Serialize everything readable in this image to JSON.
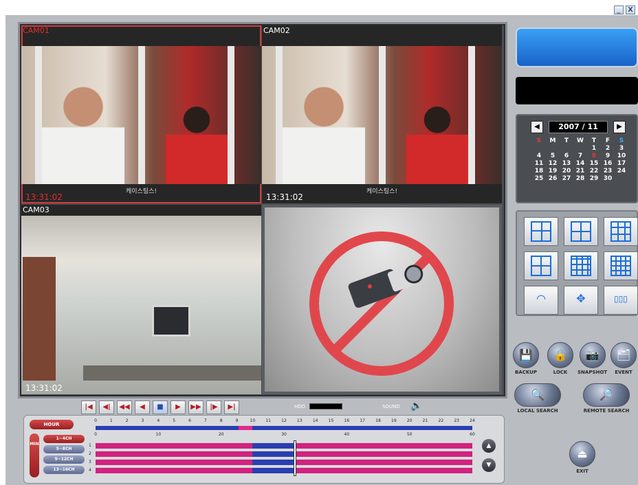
{
  "window": {
    "minimize_glyph": "_",
    "close_glyph": "X"
  },
  "cameras": [
    {
      "label": "CAM01",
      "time": "13:31:02",
      "caption": "케이스팅스!",
      "active": true
    },
    {
      "label": "CAM02",
      "time": "13:31:02",
      "caption": "케이스팅스!",
      "active": false
    },
    {
      "label": "CAM03",
      "time": "13:31:02",
      "active": false
    },
    {
      "label": "",
      "time": "",
      "no_signal": true
    }
  ],
  "playback": {
    "buttons": [
      {
        "name": "first-frame-button",
        "glyph": "|◀"
      },
      {
        "name": "prev-frame-button",
        "glyph": "◀|"
      },
      {
        "name": "fast-rewind-button",
        "glyph": "◀◀"
      },
      {
        "name": "reverse-play-button",
        "glyph": "◀"
      },
      {
        "name": "stop-button",
        "glyph": "■"
      },
      {
        "name": "play-button",
        "glyph": "▶"
      },
      {
        "name": "fast-forward-button",
        "glyph": "▶▶"
      },
      {
        "name": "next-frame-button",
        "glyph": "|▶"
      },
      {
        "name": "last-frame-button",
        "glyph": "▶|"
      }
    ],
    "hdd_label": "HDD",
    "sound_label": "SOUND"
  },
  "timeline": {
    "hour_button": "HOUR",
    "hours": [
      "0",
      "1",
      "2",
      "3",
      "4",
      "5",
      "6",
      "7",
      "8",
      "9",
      "10",
      "11",
      "12",
      "13",
      "14",
      "15",
      "16",
      "17",
      "18",
      "19",
      "20",
      "21",
      "22",
      "23",
      "24"
    ],
    "min_tag": "MIN",
    "minutes": [
      "0",
      "10",
      "20",
      "30",
      "40",
      "50",
      "60"
    ],
    "channel_buttons": [
      "1~4CH",
      "5~8CH",
      "9~12CH",
      "13~16CH"
    ],
    "channel_numbers": [
      "1",
      "2",
      "3",
      "4"
    ],
    "scroll_up": "▲",
    "scroll_down": "▼"
  },
  "calendar": {
    "year_month": "2007 / 11",
    "prev_glyph": "◀",
    "next_glyph": "▶",
    "weekdays": [
      "S",
      "M",
      "T",
      "W",
      "T",
      "F",
      "S"
    ],
    "cells": [
      "",
      "",
      "",
      "",
      "1",
      "2",
      "3",
      "4",
      "5",
      "6",
      "7",
      "8",
      "9",
      "10",
      "11",
      "12",
      "13",
      "14",
      "15",
      "16",
      "17",
      "18",
      "19",
      "20",
      "21",
      "22",
      "23",
      "24",
      "25",
      "26",
      "27",
      "28",
      "29",
      "30",
      ""
    ],
    "today": "8"
  },
  "layouts": [
    {
      "name": "layout-4ch-button",
      "glyph": ""
    },
    {
      "name": "layout-6ch-button",
      "glyph": ""
    },
    {
      "name": "layout-9ch-button",
      "glyph": ""
    },
    {
      "name": "layout-10ch-button",
      "glyph": ""
    },
    {
      "name": "layout-13ch-button",
      "glyph": ""
    },
    {
      "name": "layout-16ch-button",
      "glyph": ""
    },
    {
      "name": "rotate-button",
      "glyph": "◠"
    },
    {
      "name": "fullscreen-button",
      "glyph": "✥"
    },
    {
      "name": "sequence-button",
      "glyph": "▯▯▯"
    }
  ],
  "actions": {
    "backup": "BACKUP",
    "lock": "LOCK",
    "snapshot": "SNAPSHOT",
    "event": "EVENT",
    "local_search": "LOCAL SEARCH",
    "remote_search": "REMOTE SEARCH",
    "exit": "EXIT"
  }
}
